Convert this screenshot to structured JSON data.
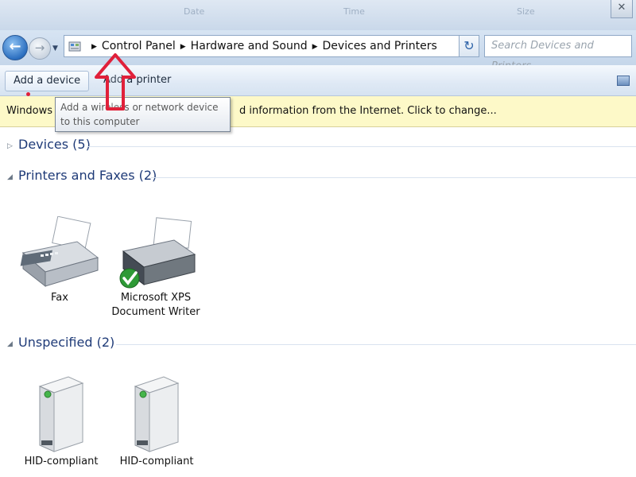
{
  "window": {
    "ghost_columns": [
      "Date",
      "Time",
      "Size"
    ],
    "close_symbol": "✕"
  },
  "nav": {
    "back_symbol": "←",
    "forward_symbol": "→",
    "history_symbol": "▼"
  },
  "address": {
    "crumbs": [
      "Control Panel",
      "Hardware and Sound",
      "Devices and Printers"
    ],
    "separator": "▶",
    "dropdown_symbol": "▼",
    "refresh_symbol": "↻"
  },
  "search": {
    "placeholder": "Search Devices and Printers"
  },
  "commands": {
    "add_device": "Add a device",
    "add_printer": "Add a printer"
  },
  "infobar": {
    "left_text": "Windows",
    "right_text": "d information from the Internet. Click to change..."
  },
  "tooltip": {
    "text": "Add a wireless or network device to this computer"
  },
  "groups": {
    "devices": {
      "title": "Devices (5)",
      "expander": "▷"
    },
    "printers": {
      "title": "Printers and Faxes (2)",
      "expander": "◢"
    },
    "unspecified": {
      "title": "Unspecified (2)",
      "expander": "◢"
    }
  },
  "printers": [
    {
      "label": "Fax",
      "icon": "fax-icon"
    },
    {
      "label_line1": "Microsoft XPS",
      "label_line2": "Document Writer",
      "icon": "printer-icon",
      "default": true
    }
  ],
  "unspecified": [
    {
      "label": "HID-compliant",
      "icon": "hid-device-icon"
    },
    {
      "label": "HID-compliant",
      "icon": "hid-device-icon"
    }
  ],
  "colors": {
    "group_title": "#1f3b78",
    "infobar": "#fdf9c8",
    "annotation_arrow": "#e0203a"
  }
}
